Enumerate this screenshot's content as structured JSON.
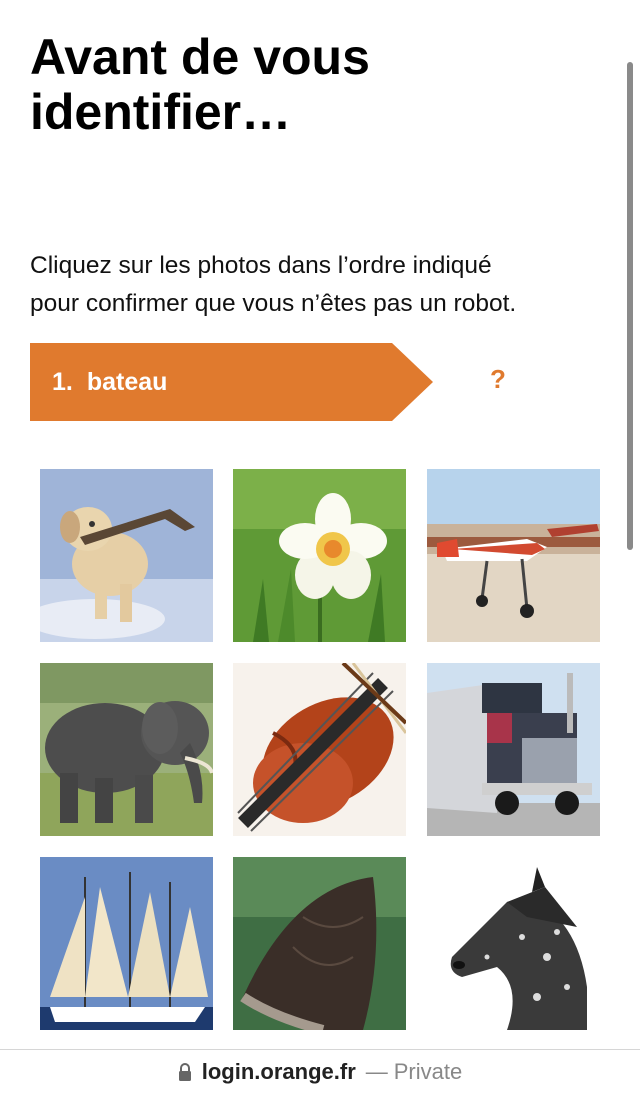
{
  "header": {
    "title_line1": "Avant de vous",
    "title_line2": "identifier…"
  },
  "instruction": {
    "line1": "Cliquez sur les photos dans l’ordre indiqué",
    "line2": "pour confirmer que vous n’êtes pas un robot."
  },
  "steps": {
    "current_number": "1.",
    "current_label": "bateau",
    "next_placeholder": "?"
  },
  "images": [
    {
      "subject": "dog"
    },
    {
      "subject": "flower"
    },
    {
      "subject": "airplane"
    },
    {
      "subject": "elephant"
    },
    {
      "subject": "violin"
    },
    {
      "subject": "truck"
    },
    {
      "subject": "sailboat"
    },
    {
      "subject": "butterfly"
    },
    {
      "subject": "horse"
    }
  ],
  "browser": {
    "domain": "login.orange.fr",
    "separator": "—",
    "mode": "Private"
  },
  "colors": {
    "accent": "#e07a2e"
  }
}
